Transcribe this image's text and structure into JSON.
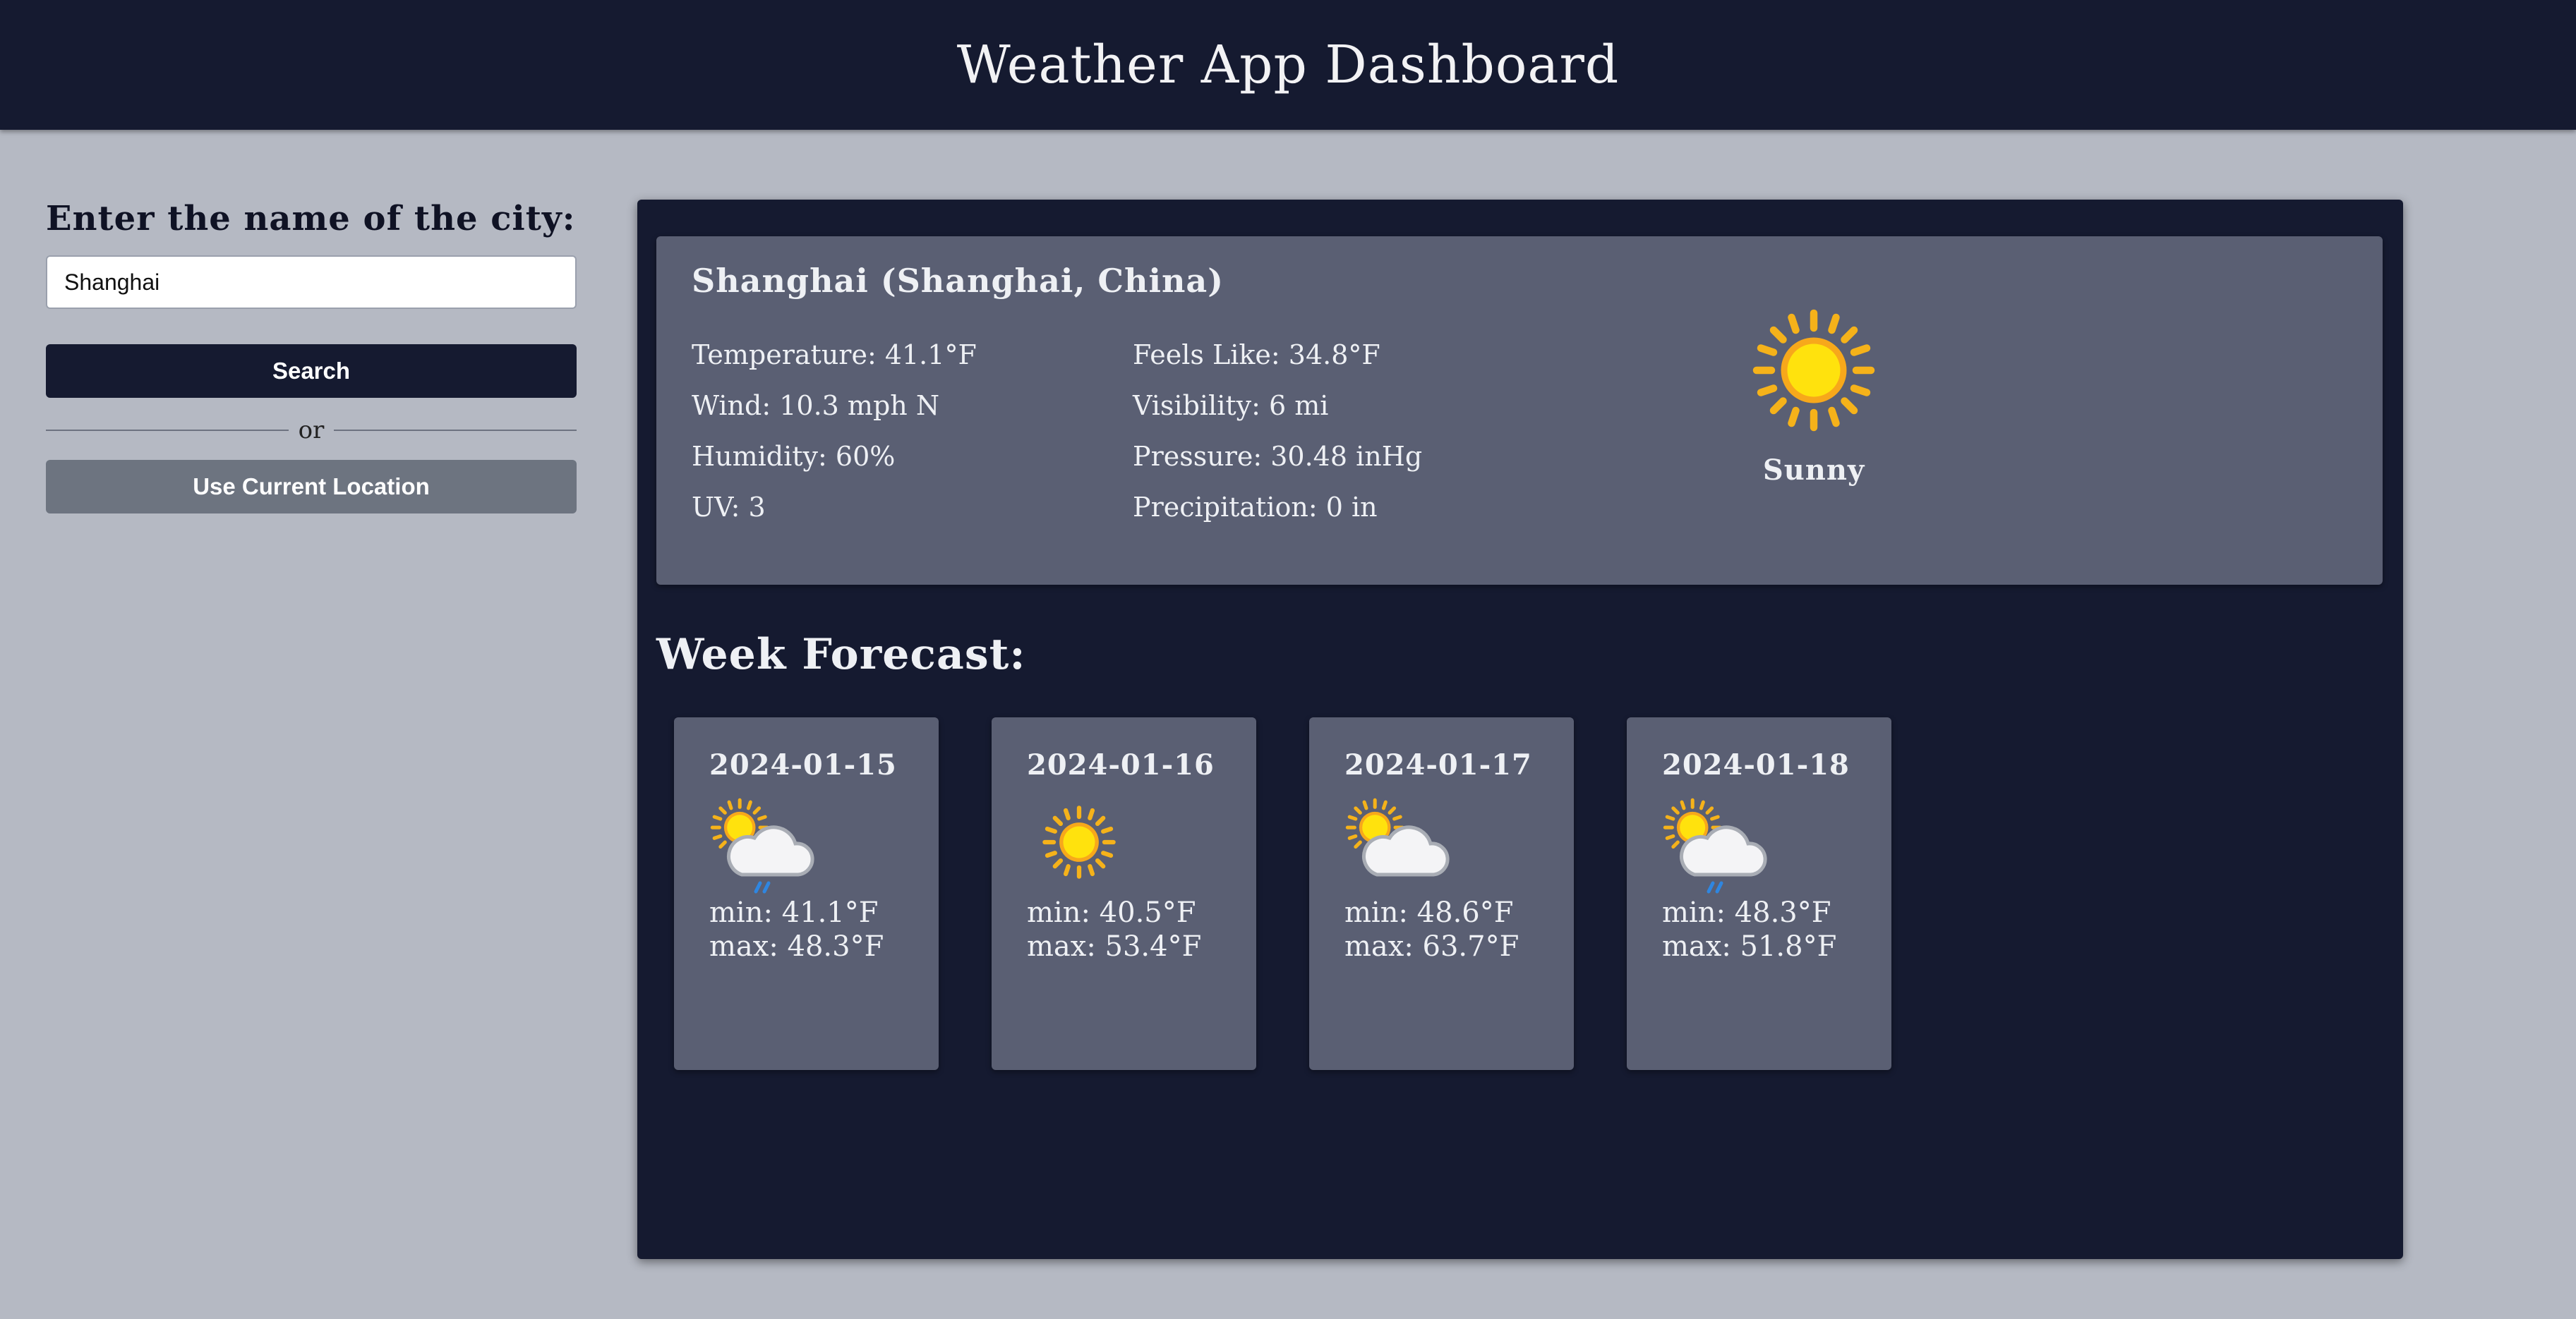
{
  "header": {
    "title": "Weather App Dashboard"
  },
  "search": {
    "label": "Enter the name of the city:",
    "input_value": "Shanghai",
    "search_button": "Search",
    "divider_text": "or",
    "location_button": "Use Current Location"
  },
  "current": {
    "city": "Shanghai (Shanghai, China)",
    "temperature": "Temperature: 41.1°F",
    "wind": "Wind: 10.3 mph N",
    "humidity": "Humidity: 60%",
    "uv": "UV: 3",
    "feels_like": "Feels Like: 34.8°F",
    "visibility": "Visibility: 6 mi",
    "pressure": "Pressure: 30.48 inHg",
    "precipitation": "Precipitation: 0 in",
    "condition": "Sunny",
    "condition_icon": "sun-icon"
  },
  "forecast": {
    "title": "Week Forecast:",
    "days": [
      {
        "date": "2024-01-15",
        "min": "min: 41.1°F",
        "max": "max: 48.3°F",
        "icon": "sun-cloud-rain-icon"
      },
      {
        "date": "2024-01-16",
        "min": "min: 40.5°F",
        "max": "max: 53.4°F",
        "icon": "sun-icon"
      },
      {
        "date": "2024-01-17",
        "min": "min: 48.6°F",
        "max": "max: 63.7°F",
        "icon": "sun-behind-cloud-icon"
      },
      {
        "date": "2024-01-18",
        "min": "min: 48.3°F",
        "max": "max: 51.8°F",
        "icon": "sun-cloud-rain-icon"
      }
    ]
  },
  "colors": {
    "page_background": "#b5b9c3",
    "header_background": "#151a30",
    "panel_background": "#151a30",
    "card_background": "#5a5f73",
    "secondary_button": "#6d7480",
    "text_light": "#eef0f4"
  }
}
